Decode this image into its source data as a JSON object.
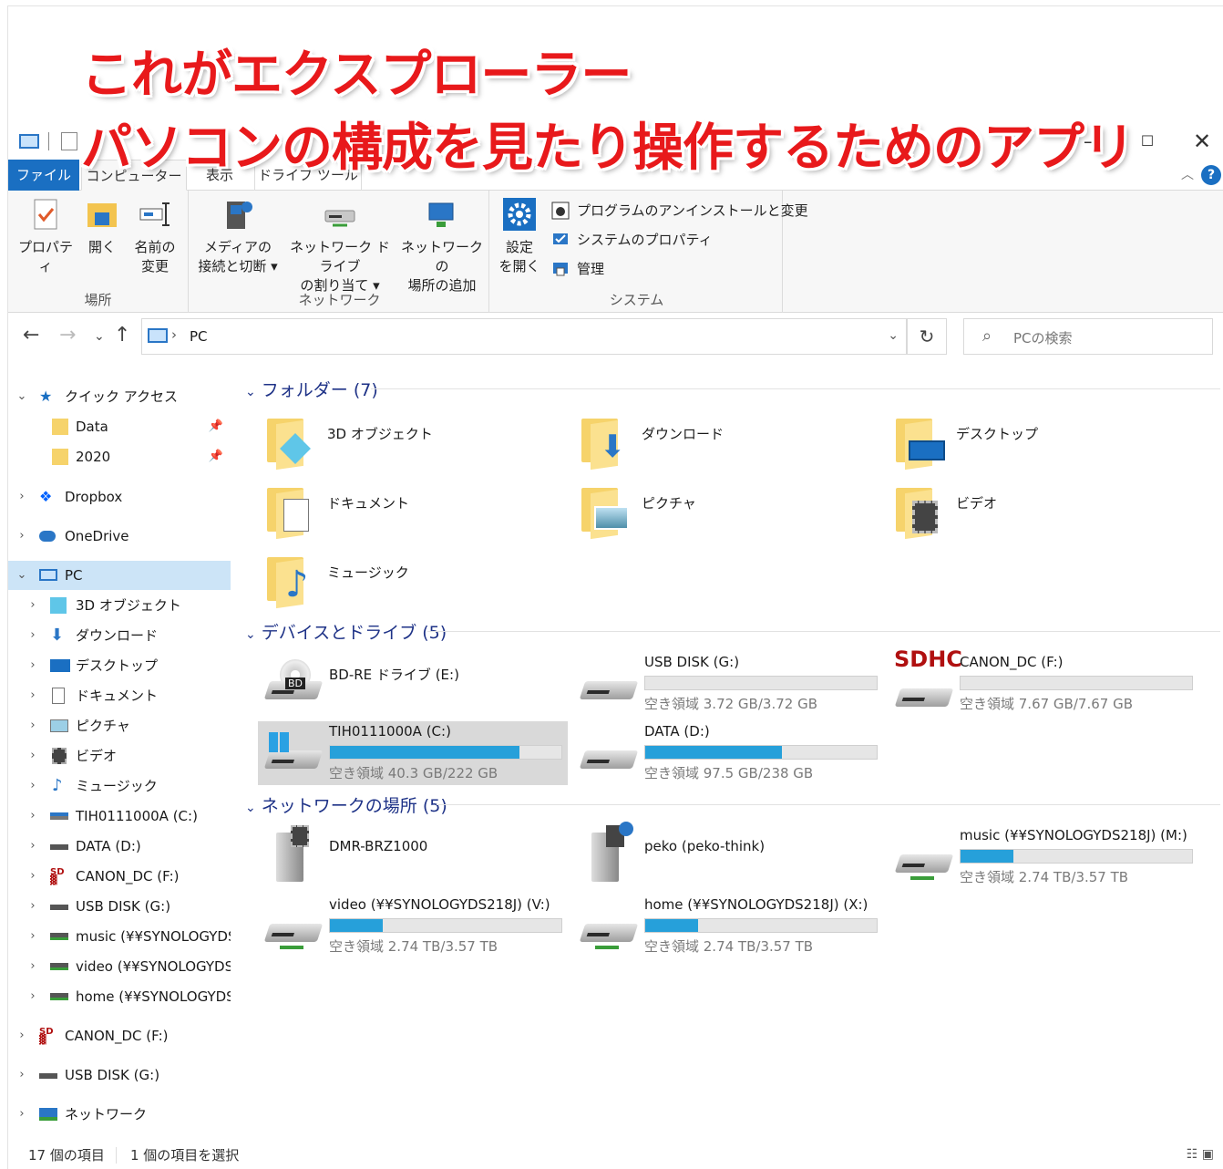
{
  "overlay": {
    "line1": "これがエクスプローラー",
    "line2": "パソコンの構成を見たり操作するためのアプリ"
  },
  "window_controls": {
    "minimize": "—",
    "maximize": "☐",
    "close": "✕"
  },
  "ribbon_tabs": {
    "file": "ファイル",
    "computer": "コンピューター",
    "view": "表示",
    "drive_tools": "ドライブ ツール"
  },
  "ribbon": {
    "location": {
      "label": "場所",
      "properties": "プロパティ",
      "open": "開く",
      "rename_line1": "名前の",
      "rename_line2": "変更"
    },
    "network": {
      "label": "ネットワーク",
      "media_line1": "メディアの",
      "media_line2": "接続と切断 ▾",
      "map_line1": "ネットワーク ドライブ",
      "map_line2": "の割り当て ▾",
      "add_line1": "ネットワークの",
      "add_line2": "場所の追加"
    },
    "system": {
      "label": "システム",
      "settings_line1": "設定",
      "settings_line2": "を開く",
      "uninstall": "プログラムのアンインストールと変更",
      "sysprops": "システムのプロパティ",
      "manage": "管理"
    }
  },
  "address": {
    "path": "PC",
    "search_placeholder": "PCの検索"
  },
  "sidebar": {
    "quick_access": "クイック アクセス",
    "qa_data": "Data",
    "qa_2020": "2020",
    "dropbox": "Dropbox",
    "onedrive": "OneDrive",
    "pc": "PC",
    "pc_children": [
      "3D オブジェクト",
      "ダウンロード",
      "デスクトップ",
      "ドキュメント",
      "ピクチャ",
      "ビデオ",
      "ミュージック",
      "TIH0111000A (C:)",
      "DATA (D:)",
      "CANON_DC (F:)",
      "USB DISK (G:)",
      "music (¥¥SYNOLOGYDS",
      "video (¥¥SYNOLOGYDS",
      "home (¥¥SYNOLOGYDS"
    ],
    "canon": "CANON_DC (F:)",
    "usb": "USB DISK (G:)",
    "network": "ネットワーク"
  },
  "groups": {
    "folders": "フォルダー (7)",
    "devices": "デバイスとドライブ (5)",
    "network": "ネットワークの場所 (5)"
  },
  "folders": [
    "3D オブジェクト",
    "ダウンロード",
    "デスクトップ",
    "ドキュメント",
    "ピクチャ",
    "ビデオ",
    "ミュージック"
  ],
  "drives": {
    "bd": {
      "name": "BD-RE ドライブ (E:)"
    },
    "usb": {
      "name": "USB DISK (G:)",
      "free": "空き領域 3.72 GB/3.72 GB",
      "used_fraction": 0.0
    },
    "canon": {
      "name": "CANON_DC (F:)",
      "free": "空き領域 7.67 GB/7.67 GB",
      "used_fraction": 0.0
    },
    "c": {
      "name": "TIH0111000A (C:)",
      "free": "空き領域 40.3 GB/222 GB",
      "used_fraction": 0.82
    },
    "d": {
      "name": "DATA (D:)",
      "free": "空き領域 97.5 GB/238 GB",
      "used_fraction": 0.59
    }
  },
  "netplaces": {
    "dmr": {
      "name": "DMR-BRZ1000"
    },
    "peko": {
      "name": "peko (peko-think)"
    },
    "music": {
      "name": "music (¥¥SYNOLOGYDS218J) (M:)",
      "free": "空き領域 2.74 TB/3.57 TB",
      "used_fraction": 0.23
    },
    "video": {
      "name": "video (¥¥SYNOLOGYDS218J) (V:)",
      "free": "空き領域 2.74 TB/3.57 TB",
      "used_fraction": 0.23
    },
    "home": {
      "name": "home (¥¥SYNOLOGYDS218J) (X:)",
      "free": "空き領域 2.74 TB/3.57 TB",
      "used_fraction": 0.23
    }
  },
  "sdhc_label": "SDHC",
  "status": {
    "count": "17 個の項目",
    "selected": "1 個の項目を選択"
  }
}
